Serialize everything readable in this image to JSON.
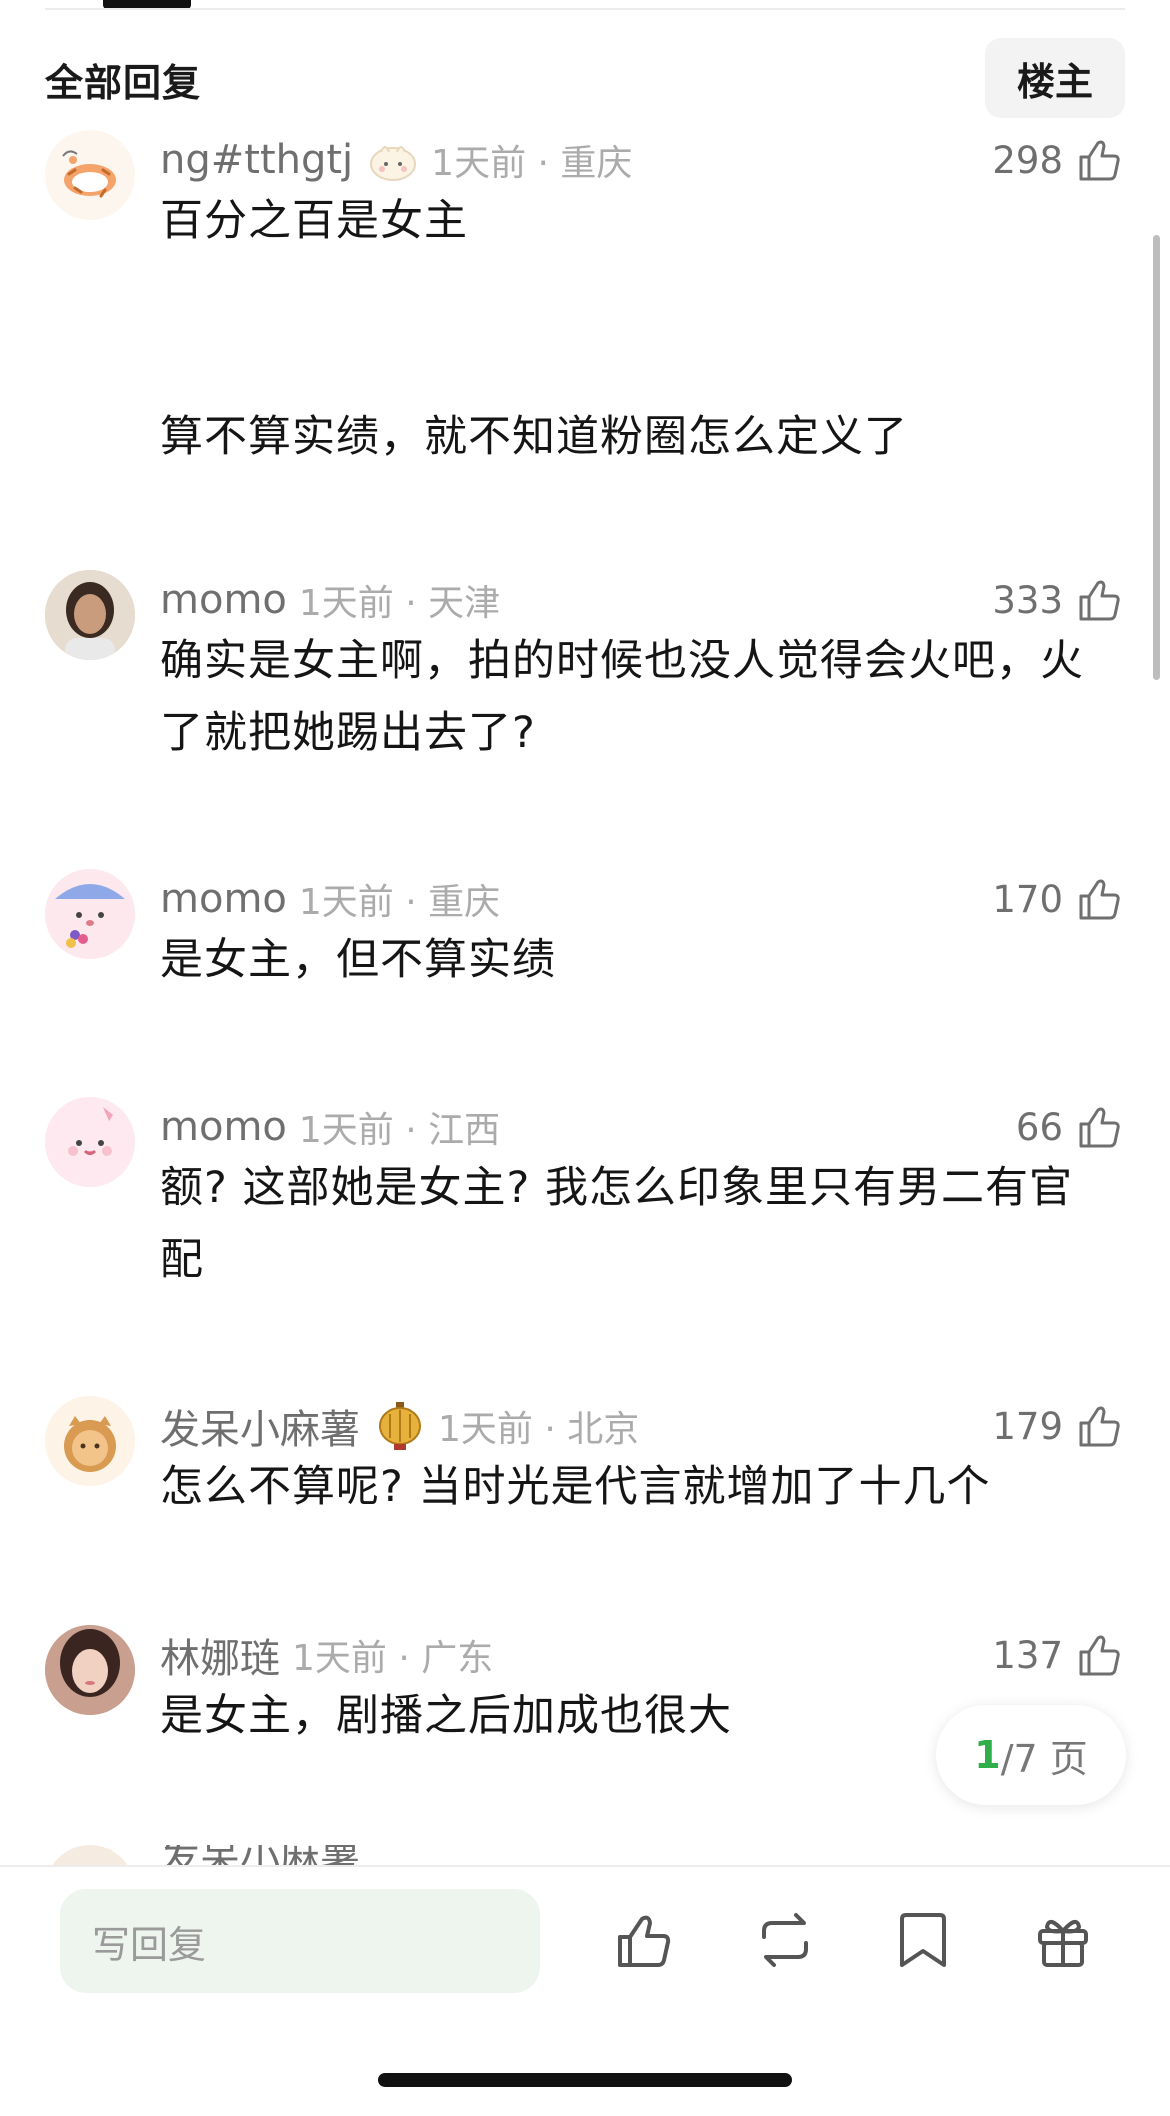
{
  "header": {
    "title": "全部回复",
    "op_label": "楼主"
  },
  "comments": [
    {
      "username": "ng#tthgtj",
      "time_loc": "1天前 · 重庆",
      "likes": "298",
      "paragraphs": [
        "百分之百是女主",
        "算不算实绩，就不知道粉圈怎么定义了"
      ],
      "avatar": "cartoon-tiger-avatar",
      "badge": "bun-badge-icon"
    },
    {
      "username": "momo",
      "time_loc": "1天前 · 天津",
      "likes": "333",
      "paragraphs": [
        "确实是女主啊，拍的时候也没人觉得会火吧，火了就把她踢出去了?"
      ],
      "avatar": "girl-photo-avatar"
    },
    {
      "username": "momo",
      "time_loc": "1天前 · 重庆",
      "likes": "170",
      "paragraphs": [
        "是女主，但不算实绩"
      ],
      "avatar": "pink-blob-flower-avatar"
    },
    {
      "username": "momo",
      "time_loc": "1天前 · 江西",
      "likes": "66",
      "paragraphs": [
        "额? 这部她是女主? 我怎么印象里只有男二有官配"
      ],
      "avatar": "pink-blob-avatar"
    },
    {
      "username": "发呆小麻薯",
      "time_loc": "1天前 · 北京",
      "likes": "179",
      "paragraphs": [
        "怎么不算呢? 当时光是代言就增加了十几个"
      ],
      "avatar": "cookie-cat-avatar",
      "badge": "lantern-badge-icon"
    },
    {
      "username": "林娜琏",
      "time_loc": "1天前 · 广东",
      "likes": "137",
      "paragraphs": [
        "是女主，剧播之后加成也很大"
      ],
      "avatar": "woman-photo-avatar"
    }
  ],
  "partial_row": {
    "text": "发呆小麻薯"
  },
  "pager": {
    "current": "1",
    "rest": "/7 页"
  },
  "bottom_bar": {
    "reply_placeholder": "写回复"
  },
  "colors": {
    "accent_green": "#2fae4a",
    "reply_bg": "#eef5ef"
  }
}
